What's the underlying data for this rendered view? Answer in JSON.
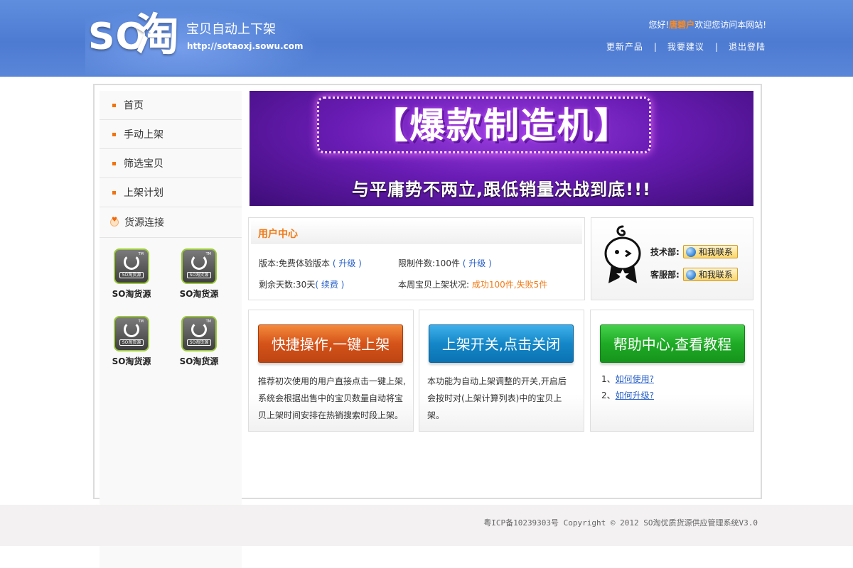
{
  "header": {
    "logo_so": "SO",
    "logo_tao": "淘",
    "tagline": "宝贝自动上下架",
    "url": "http://sotaoxj.sowu.com",
    "greeting_prefix": "您好!",
    "username": "唐碧户",
    "greeting_suffix": "欢迎您访问本网站!",
    "nav": [
      {
        "label": "更新产品"
      },
      {
        "label": "我要建议"
      },
      {
        "label": "退出登陆"
      }
    ],
    "nav_separator": "|"
  },
  "sidebar": {
    "items": [
      {
        "label": "首页"
      },
      {
        "label": "手动上架"
      },
      {
        "label": "筛选宝贝"
      },
      {
        "label": "上架计划"
      },
      {
        "label": "货源连接"
      }
    ],
    "sources": [
      {
        "label": "SO淘货源",
        "icon_badge": "SO淘货源",
        "tm": "TM"
      },
      {
        "label": "SO淘货源",
        "icon_badge": "SO淘货源",
        "tm": "TM"
      },
      {
        "label": "SO淘货源",
        "icon_badge": "SO淘货源",
        "tm": "TM"
      },
      {
        "label": "SO淘货源",
        "icon_badge": "SO淘货源",
        "tm": "TM"
      }
    ]
  },
  "banner": {
    "headline": "【爆款制造机】",
    "slogan": "与平庸势不两立,跟低销量决战到底!!!"
  },
  "user_center": {
    "title": "用户中心",
    "version_label": "版本:免费体验版本",
    "upgrade_link": "( 升级 )",
    "limit_label": "限制件数:100件",
    "limit_upgrade_link": "( 升级 )",
    "days_label": "剩余天数:30天",
    "renew_link": "( 续费 )",
    "weekly_label": "本周宝贝上架状况:",
    "weekly_status": "成功100件,失败5件"
  },
  "contact": {
    "tech_label": "技术部:",
    "service_label": "客服部:",
    "contact_button": "和我联系"
  },
  "cards": {
    "quick": {
      "button": "快捷操作,一键上架",
      "text": "推荐初次使用的用户直接点击一键上架,系统会根据出售中的宝贝数量自动将宝贝上架时间安排在热销搜索时段上架。"
    },
    "switch": {
      "button": "上架开关,点击关闭",
      "text": "本功能为自动上架调整的开关,开启后会按时对(上架计算列表)中的宝贝上架。"
    },
    "help": {
      "button": "帮助中心,查看教程",
      "items": [
        {
          "num": "1、",
          "label": "如何使用?"
        },
        {
          "num": "2、",
          "label": "如何升级?"
        }
      ]
    }
  },
  "footer": {
    "text": "粤ICP备10239303号 Copyright © 2012 SO淘优质货源供应管理系统V3.0"
  },
  "colors": {
    "header_blue": "#5580d6",
    "accent_orange": "#f27a16",
    "link_blue": "#2a61c8"
  }
}
